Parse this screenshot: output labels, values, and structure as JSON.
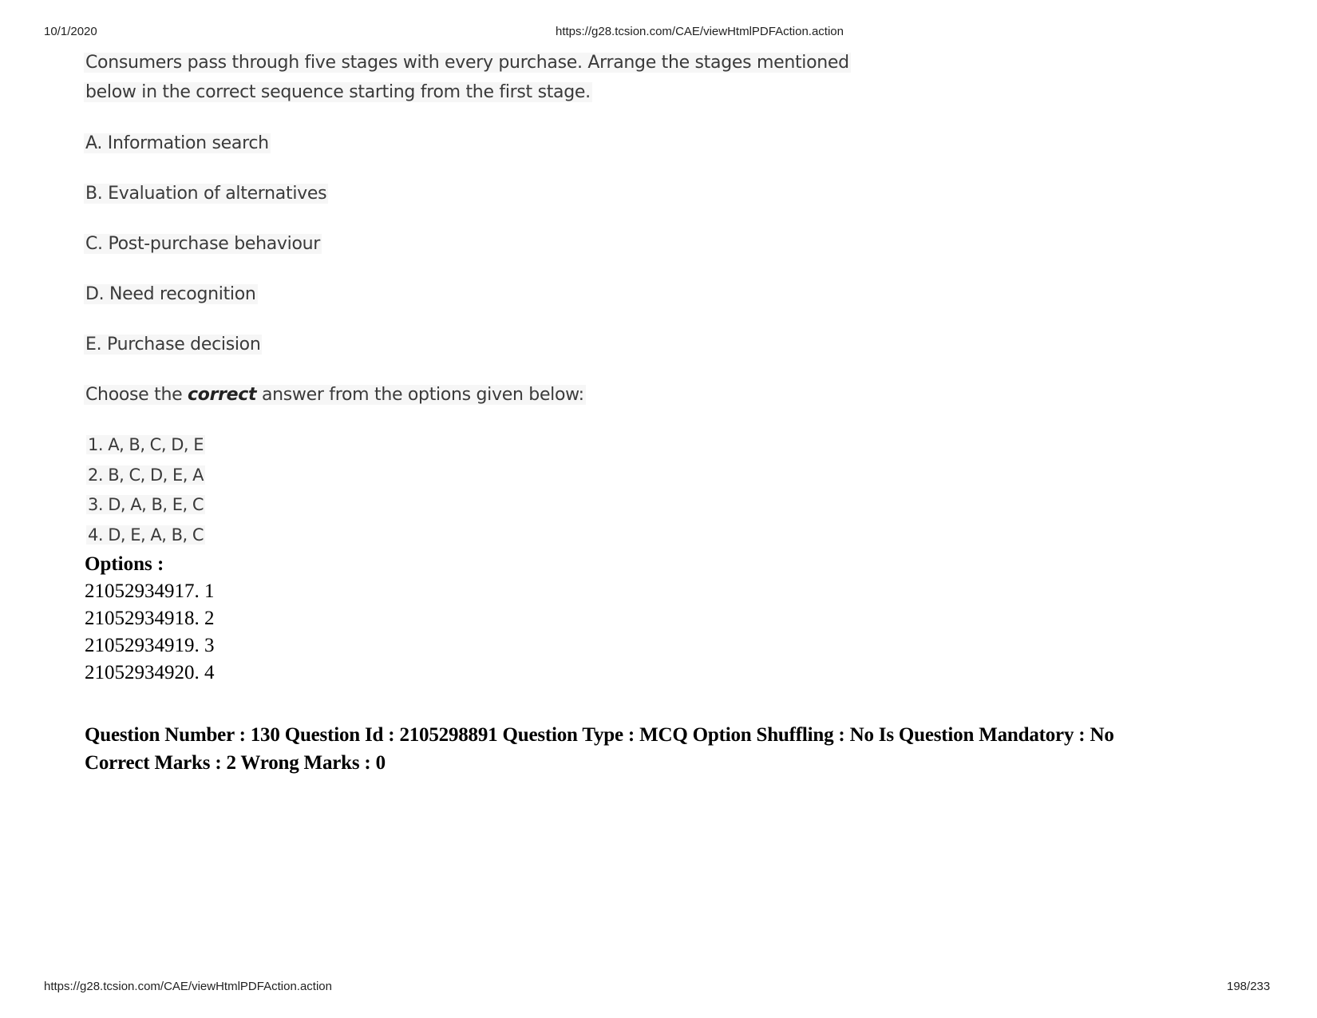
{
  "header": {
    "date": "10/1/2020",
    "url": "https://g28.tcsion.com/CAE/viewHtmlPDFAction.action"
  },
  "question": {
    "stem_line1": "Consumers pass through five stages with every purchase. Arrange the stages mentioned",
    "stem_line2": "below in the correct sequence starting from the first stage.",
    "stages": [
      "A. Information search",
      "B. Evaluation of alternatives",
      "C. Post-purchase behaviour",
      "D. Need recognition",
      "E. Purchase decision"
    ],
    "choose_prefix": "Choose the ",
    "choose_emphasis": "correct",
    "choose_suffix": " answer from the options given below:",
    "sequences": [
      "1. A, B, C, D, E",
      "2. B, C, D, E, A",
      "3. D, A, B, E, C",
      "4. D, E, A, B, C"
    ]
  },
  "options": {
    "heading": "Options :",
    "items": [
      "21052934917. 1",
      "21052934918. 2",
      "21052934919. 3",
      "21052934920. 4"
    ]
  },
  "next_question_meta": {
    "line1": "Question Number : 130 Question Id : 2105298891 Question Type : MCQ Option Shuffling : No Is Question Mandatory : No",
    "line2": "Correct Marks : 2 Wrong Marks : 0"
  },
  "footer": {
    "url": "https://g28.tcsion.com/CAE/viewHtmlPDFAction.action",
    "page": "198/233"
  }
}
